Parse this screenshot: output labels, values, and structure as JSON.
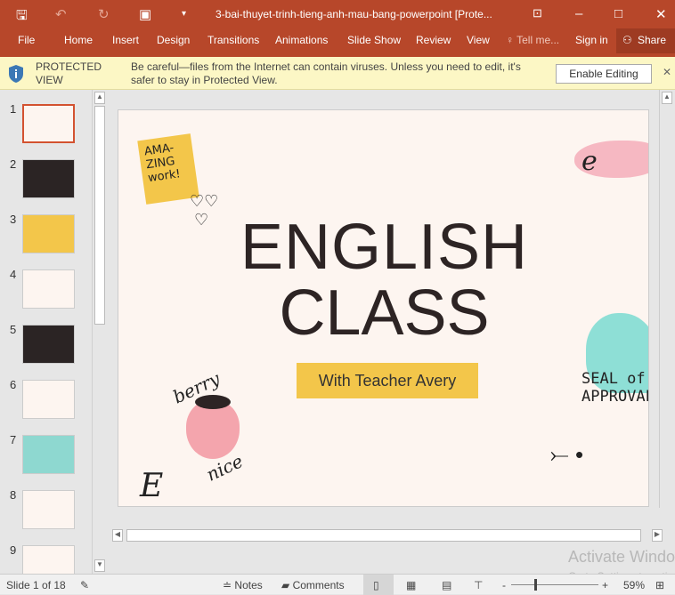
{
  "window": {
    "title": "3-bai-thuyet-trinh-tieng-anh-mau-bang-powerpoint [Prote...",
    "minimize": "–",
    "maximize": "□",
    "close": "✕"
  },
  "ribbon": {
    "tabs": [
      "File",
      "Home",
      "Insert",
      "Design",
      "Transitions",
      "Animations",
      "Slide Show",
      "Review",
      "View"
    ],
    "tell_me": "Tell me...",
    "sign_in": "Sign in",
    "share": "Share"
  },
  "protected_view": {
    "label_line1": "PROTECTED",
    "label_line2": "VIEW",
    "message_line1": "Be careful—files from the Internet can contain viruses. Unless you need to edit, it's",
    "message_line2": "safer to stay in Protected View.",
    "button": "Enable Editing",
    "close": "✕"
  },
  "thumbnails": [
    {
      "n": "1",
      "bg": "#fdf5f0"
    },
    {
      "n": "2",
      "bg": "#2b2424"
    },
    {
      "n": "3",
      "bg": "#f3c64a"
    },
    {
      "n": "4",
      "bg": "#fdf5f0"
    },
    {
      "n": "5",
      "bg": "#2b2424"
    },
    {
      "n": "6",
      "bg": "#fdf5f0"
    },
    {
      "n": "7",
      "bg": "#8ed8d0"
    },
    {
      "n": "8",
      "bg": "#fdf5f0"
    },
    {
      "n": "9",
      "bg": "#fdf5f0"
    }
  ],
  "slide": {
    "title1": "ENGLISH",
    "title2": "CLASS",
    "subtitle": "With Teacher Avery",
    "book": "AMA-\nZING\nwork!",
    "berry": "berry",
    "nice": "nice",
    "seal": "SEAL of\nAPPROVAL",
    "letter": "E"
  },
  "status": {
    "slide": "Slide 1 of 18",
    "notes": "Notes",
    "comments": "Comments",
    "zoom": "59%",
    "minus": "-",
    "plus": "+"
  },
  "watermark": {
    "line1": "Activate Windows",
    "line2": "Go to Settings to activate"
  },
  "colors": {
    "accent": "#b7472a",
    "highlight": "#f3c64a"
  }
}
